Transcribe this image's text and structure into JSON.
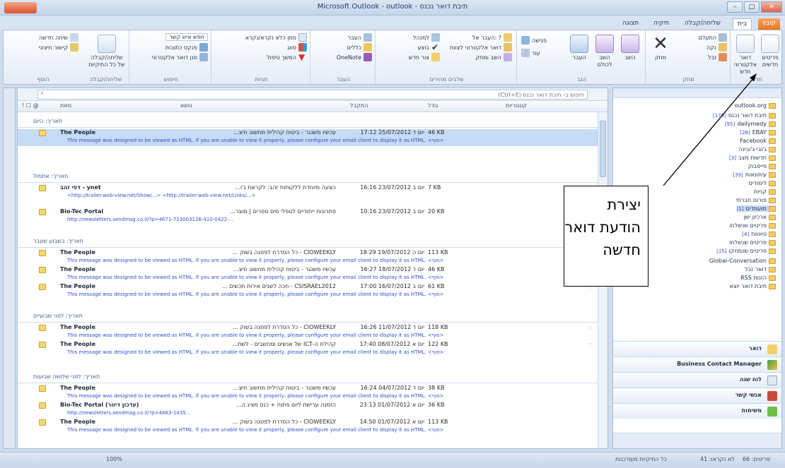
{
  "window": {
    "title": "Microsoft Outlook - outlook - תיבת דואר נכנס"
  },
  "ribbon_tabs": [
    "קובץ",
    "בית",
    "שליחה/קבלה",
    "תיקיה",
    "תצוגה"
  ],
  "ribbon": {
    "groups": [
      {
        "label": "חדש",
        "buttons": [
          "דואר אלקטרוני חדש",
          "פריטים חדשים"
        ]
      },
      {
        "label": "מחק",
        "buttons": [
          "התעלם",
          "נקה",
          "זבל",
          "מחק"
        ]
      },
      {
        "label": "הגב",
        "buttons": [
          "השב",
          "השב לכולם",
          "העבר",
          "פגישה",
          "עוד"
        ]
      },
      {
        "label": "שלבים מהירים",
        "buttons": [
          "העבר אל: ?",
          "דואר אלקטרוני לצוות",
          "השב ומחק",
          "למנהל",
          "בוצע",
          "צור חדש"
        ]
      },
      {
        "label": "העבר",
        "buttons": [
          "העבר",
          "כללים",
          "OneNote"
        ]
      },
      {
        "label": "תגיות",
        "buttons": [
          "סמן כלא נקרא/נקרא",
          "סווג",
          "המשך טיפול"
        ]
      },
      {
        "label": "חיפוש",
        "buttons": [
          "חפש איש קשר",
          "פנקס כתובות",
          "סנן דואר אלקטרוני"
        ]
      },
      {
        "label": "שליחה/קבלה",
        "buttons": [
          "שליחה/קבלה של כל התיקיות"
        ]
      },
      {
        "label": "הוסף",
        "buttons": [
          "שיחה חדשה",
          "קישור חיצוני"
        ]
      }
    ]
  },
  "search": {
    "placeholder": "חיפוש ב- תיבת דואר נכנס (Ctrl+E)"
  },
  "columns": {
    "from": "מאת",
    "subject": "נושא",
    "received": "התקבל",
    "size": "גודל",
    "categories": "קטגוריות",
    "icons": "! ☐ @"
  },
  "groups": [
    {
      "label": "תאריך: היום"
    },
    {
      "label": "תאריך: אתמול"
    },
    {
      "label": "תאריך: בשבוע שעבר"
    },
    {
      "label": "תאריך: לפני שבועיים"
    },
    {
      "label": "תאריך: לפני שלושה שבועות"
    }
  ],
  "messages": [
    {
      "from": "The People",
      "subject": "עכשיו משנגר - ביטוח קהילית מחשוב חיצ...",
      "date": "יום ד 25/07/2012 17:12",
      "size": "46 KB",
      "preview": "This message was designed to be viewed as HTML. If you are unable to view it properly, please configure your email client to display it as HTML. <סוף>"
    },
    {
      "from": "דפי זהב - ynet",
      "subject": "הצעה מיוחדת ללקוחות זהב: לקראת ג'ו...",
      "date": "יום ב 23/07/2012 16:16",
      "size": "7 KB",
      "preview": "<http://trailer-web-view.net/Show/...>  <http://trailer-web-view.net/Links/...>"
    },
    {
      "from": "Bio-Tec Portal",
      "subject": "פתרונות ייחודיים לטפלי מים ספרים | מוצר...",
      "date": "יום ב 23/07/2012 10:16",
      "size": "20 KB",
      "preview": "http://newsletters.sendmag.co.il/?p=4671-723003126-410-0422-..."
    },
    {
      "from": "The People",
      "subject": "CIOWEEKLY - כל הסדרת לפסגה בשוק ...",
      "date": "יום ה 19/07/2012 18:29",
      "size": "113 KB",
      "preview": "This message was designed to be viewed as HTML. If you are unable to view it properly, please configure your email client to display it as HTML. <סוף>"
    },
    {
      "from": "The People",
      "subject": "עכשיו משנגר - ביטוח קהילית מחשוב חיצ...",
      "date": "יום ד 18/07/2012 16:27",
      "size": "46 KB",
      "preview": "This message was designed to be viewed as HTML. If you are unable to view it properly, please configure your email client to display it as HTML. <סוף>"
    },
    {
      "from": "The People",
      "subject": "CSISRAEL2012 - חכה לשנים אירות תכשים ...",
      "date": "יום ב 16/07/2012 17:00",
      "size": "61 KB",
      "preview": "This message was designed to be viewed as HTML. If you are unable to view it properly, please configure your email client to display it as HTML. <סוף>"
    },
    {
      "from": "The People",
      "subject": "CIOWEEKLY - כל הסדרת לפסגה בשוק ...",
      "date": "יום ד 11/07/2012 16:26",
      "size": "118 KB",
      "preview": "This message was designed to be viewed as HTML. If you are unable to view it properly, please configure your email client to display it as HTML. <סוף>"
    },
    {
      "from": "The People",
      "subject": "קהילת ה-ICT של אנשים ומחשבים - לשת...",
      "date": "יום א 08/07/2012 17:40",
      "size": "122 KB",
      "preview": "This message was designed to be viewed as HTML. If you are unable to view it properly, please configure your email client to display it as HTML. <סוף>"
    },
    {
      "from": "The People",
      "subject": "עכשיו משנגר - ביטוח קהילית מחשוב חיצ...",
      "date": "יום ד 04/07/2012 16:24",
      "size": "38 KB",
      "preview": "This message was designed to be viewed as HTML. If you are unable to view it properly, please configure your email client to display it as HTML. <סוף>"
    },
    {
      "from": "Bio-Tec Portal (עדכון דיוור)",
      "subject": "הזמנה ערישת ליום פתוח + כנס מציג ה...",
      "date": "יום א 01/07/2012 23:13",
      "size": "36 KB",
      "preview": "http://newsletters.sendmag.co.il/?p=4463-1435..."
    },
    {
      "from": "The People",
      "subject": "CIOWEEKLY - כל הסדרת לפסגה בשוק ...",
      "date": "יום א 01/07/2012 14:50",
      "size": "113 KB",
      "preview": "This message was designed to be viewed as HTML. If you are unable to view it properly, please configure your email client to display it as HTML. <סוף>"
    }
  ],
  "folders": [
    {
      "name": "outlook.org",
      "count": ""
    },
    {
      "name": "תיבת דואר נכנס",
      "count": "[176]"
    },
    {
      "name": "dailymedy",
      "count": "[95]"
    },
    {
      "name": "EBAY",
      "count": "[28]"
    },
    {
      "name": "Facebook",
      "count": ""
    },
    {
      "name": "ג'ובי-ג'ובינה",
      "count": ""
    },
    {
      "name": "חדשות מצב",
      "count": "[3]"
    },
    {
      "name": "פייסבוק",
      "count": ""
    },
    {
      "name": "עיתונאות",
      "count": "[39]"
    },
    {
      "name": "לימודים",
      "count": ""
    },
    {
      "name": "קניות",
      "count": ""
    },
    {
      "name": "פורום חברתי",
      "count": ""
    },
    {
      "name": "מועמדים",
      "count": "[1]"
    },
    {
      "name": "ארכיון ישן",
      "count": ""
    },
    {
      "name": "פריטים שנשלחו",
      "count": ""
    },
    {
      "name": "טיוטות",
      "count": "[4]"
    },
    {
      "name": "פריטים שנשלחו",
      "count": ""
    },
    {
      "name": "פריטים שנמחקו",
      "count": "[15]"
    },
    {
      "name": "Global-Conversation",
      "count": ""
    },
    {
      "name": "דואר זבל",
      "count": ""
    },
    {
      "name": "RSS הזנות",
      "count": ""
    },
    {
      "name": "תיבת דואר יוצא",
      "count": ""
    }
  ],
  "nav_buttons": [
    {
      "label": "דואר"
    },
    {
      "label": "Business Contact Manager"
    },
    {
      "label": "לוח שנה"
    },
    {
      "label": "אנשי קשר"
    },
    {
      "label": "משימות"
    }
  ],
  "status": {
    "items": "פריטים: 66",
    "unread": "לא נקראו: 41",
    "sync": "כל התיקיות מעודכנות",
    "zoom": "100%"
  },
  "callout": {
    "text": "יצירת הודעת דואר חדשה"
  },
  "colors": {
    "selection": "#c6dbf5",
    "link": "#2f50c8",
    "accent_file": "#e9731d"
  }
}
